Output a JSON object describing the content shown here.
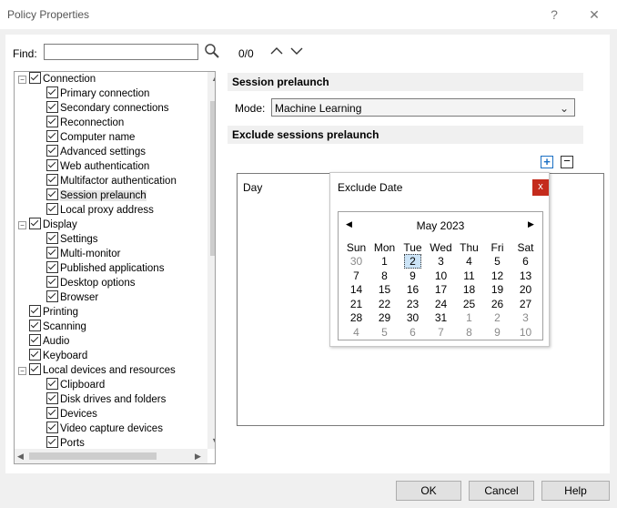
{
  "window": {
    "title": "Policy Properties",
    "help_glyph": "?",
    "close_glyph": "✕"
  },
  "find": {
    "label": "Find:",
    "value": "",
    "count": "0/0"
  },
  "tree": [
    {
      "label": "Connection",
      "level": 0,
      "expander": "−"
    },
    {
      "label": "Primary connection",
      "level": 1
    },
    {
      "label": "Secondary connections",
      "level": 1
    },
    {
      "label": "Reconnection",
      "level": 1
    },
    {
      "label": "Computer name",
      "level": 1
    },
    {
      "label": "Advanced settings",
      "level": 1
    },
    {
      "label": "Web authentication",
      "level": 1
    },
    {
      "label": "Multifactor authentication",
      "level": 1
    },
    {
      "label": "Session prelaunch",
      "level": 1,
      "selected": true
    },
    {
      "label": "Local proxy address",
      "level": 1
    },
    {
      "label": "Display",
      "level": 0,
      "expander": "−"
    },
    {
      "label": "Settings",
      "level": 1
    },
    {
      "label": "Multi-monitor",
      "level": 1
    },
    {
      "label": "Published applications",
      "level": 1
    },
    {
      "label": "Desktop options",
      "level": 1
    },
    {
      "label": "Browser",
      "level": 1
    },
    {
      "label": "Printing",
      "level": 0
    },
    {
      "label": "Scanning",
      "level": 0
    },
    {
      "label": "Audio",
      "level": 0
    },
    {
      "label": "Keyboard",
      "level": 0
    },
    {
      "label": "Local devices and resources",
      "level": 0,
      "expander": "−"
    },
    {
      "label": "Clipboard",
      "level": 1
    },
    {
      "label": "Disk drives and folders",
      "level": 1
    },
    {
      "label": "Devices",
      "level": 1
    },
    {
      "label": "Video capture devices",
      "level": 1
    },
    {
      "label": "Ports",
      "level": 1
    }
  ],
  "session_prelaunch": {
    "header": "Session prelaunch",
    "mode_label": "Mode:",
    "mode_value": "Machine Learning"
  },
  "exclude": {
    "header": "Exclude sessions prelaunch",
    "add_glyph": "+",
    "remove_glyph": "−",
    "column_day": "Day"
  },
  "popup": {
    "title": "Exclude Date",
    "close_glyph": "x",
    "month_label": "May 2023",
    "weekdays": [
      "Sun",
      "Mon",
      "Tue",
      "Wed",
      "Thu",
      "Fri",
      "Sat"
    ],
    "weeks": [
      [
        {
          "d": "30",
          "o": true
        },
        {
          "d": "1"
        },
        {
          "d": "2",
          "t": true
        },
        {
          "d": "3"
        },
        {
          "d": "4"
        },
        {
          "d": "5"
        },
        {
          "d": "6"
        }
      ],
      [
        {
          "d": "7"
        },
        {
          "d": "8"
        },
        {
          "d": "9"
        },
        {
          "d": "10"
        },
        {
          "d": "11"
        },
        {
          "d": "12"
        },
        {
          "d": "13"
        }
      ],
      [
        {
          "d": "14"
        },
        {
          "d": "15"
        },
        {
          "d": "16"
        },
        {
          "d": "17"
        },
        {
          "d": "18"
        },
        {
          "d": "19"
        },
        {
          "d": "20"
        }
      ],
      [
        {
          "d": "21"
        },
        {
          "d": "22"
        },
        {
          "d": "23"
        },
        {
          "d": "24"
        },
        {
          "d": "25"
        },
        {
          "d": "26"
        },
        {
          "d": "27"
        }
      ],
      [
        {
          "d": "28"
        },
        {
          "d": "29"
        },
        {
          "d": "30"
        },
        {
          "d": "31"
        },
        {
          "d": "1",
          "o": true
        },
        {
          "d": "2",
          "o": true
        },
        {
          "d": "3",
          "o": true
        }
      ],
      [
        {
          "d": "4",
          "o": true
        },
        {
          "d": "5",
          "o": true
        },
        {
          "d": "6",
          "o": true
        },
        {
          "d": "7",
          "o": true
        },
        {
          "d": "8",
          "o": true
        },
        {
          "d": "9",
          "o": true
        },
        {
          "d": "10",
          "o": true
        }
      ]
    ]
  },
  "buttons": {
    "ok": "OK",
    "cancel": "Cancel",
    "help": "Help"
  }
}
